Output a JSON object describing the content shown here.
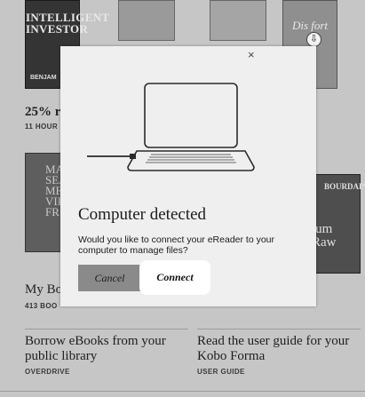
{
  "library": {
    "book1": {
      "title": "INTELLIGENT INVESTOR",
      "author_fragment": "BENJAM"
    },
    "book4": {
      "title_fragment": "Dis fort"
    },
    "book5": {
      "title_fragment": "MA SEA F MEA VIKT FR"
    },
    "book6": {
      "title_top": "BOURDAIN",
      "title_main": "ium Raw"
    },
    "progress_text": "25% re",
    "hours_text": "11 HOUR",
    "shelf_title": "My Bo",
    "shelf_count": "413 BOO"
  },
  "links": [
    {
      "title": "Borrow eBooks from your public library",
      "sub": "OVERDRIVE"
    },
    {
      "title": "Read the user guide for your Kobo Forma",
      "sub": "USER GUIDE"
    }
  ],
  "dialog": {
    "title": "Computer detected",
    "message": "Would you like to connect your eReader to your computer to manage files?",
    "cancel_label": "Cancel",
    "connect_label": "Connect",
    "close_glyph": "×"
  },
  "icons": {
    "download": "download-icon",
    "close": "close-icon",
    "illustration": "laptop-usb-illustration"
  }
}
